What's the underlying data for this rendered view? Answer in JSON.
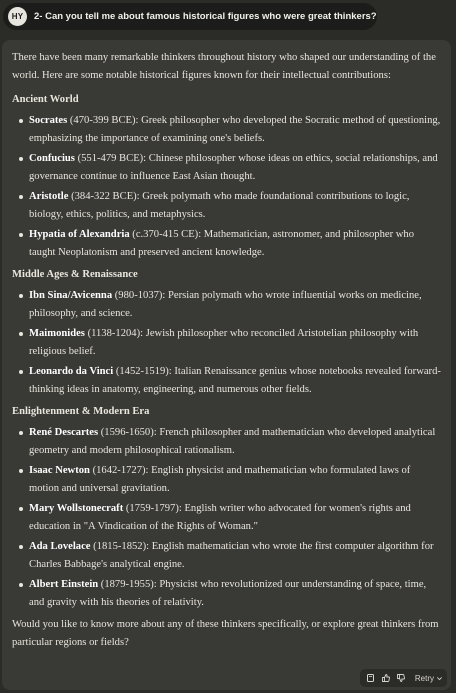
{
  "user_message": {
    "avatar_initials": "HY",
    "text": "2- Can you tell me about famous historical figures who were great thinkers?"
  },
  "answer": {
    "intro": "There have been many remarkable thinkers throughout history who shaped our understanding of the world. Here are some notable historical figures known for their intellectual contributions:",
    "sections": [
      {
        "heading": "Ancient World",
        "items": [
          {
            "name": "Socrates",
            "desc": " (470-399 BCE): Greek philosopher who developed the Socratic method of questioning, emphasizing the importance of examining one's beliefs."
          },
          {
            "name": "Confucius",
            "desc": " (551-479 BCE): Chinese philosopher whose ideas on ethics, social relationships, and governance continue to influence East Asian thought."
          },
          {
            "name": "Aristotle",
            "desc": " (384-322 BCE): Greek polymath who made foundational contributions to logic, biology, ethics, politics, and metaphysics."
          },
          {
            "name": "Hypatia of Alexandria",
            "desc": " (c.370-415 CE): Mathematician, astronomer, and philosopher who taught Neoplatonism and preserved ancient knowledge."
          }
        ]
      },
      {
        "heading": "Middle Ages & Renaissance",
        "items": [
          {
            "name": "Ibn Sina/Avicenna",
            "desc": " (980-1037): Persian polymath who wrote influential works on medicine, philosophy, and science."
          },
          {
            "name": "Maimonides",
            "desc": " (1138-1204): Jewish philosopher who reconciled Aristotelian philosophy with religious belief."
          },
          {
            "name": "Leonardo da Vinci",
            "desc": " (1452-1519): Italian Renaissance genius whose notebooks revealed forward-thinking ideas in anatomy, engineering, and numerous other fields."
          }
        ]
      },
      {
        "heading": "Enlightenment & Modern Era",
        "items": [
          {
            "name": "René Descartes",
            "desc": " (1596-1650): French philosopher and mathematician who developed analytical geometry and modern philosophical rationalism."
          },
          {
            "name": "Isaac Newton",
            "desc": " (1642-1727): English physicist and mathematician who formulated laws of motion and universal gravitation."
          },
          {
            "name": "Mary Wollstonecraft",
            "desc": " (1759-1797): English writer who advocated for women's rights and education in \"A Vindication of the Rights of Woman.\""
          },
          {
            "name": "Ada Lovelace",
            "desc": " (1815-1852): English mathematician who wrote the first computer algorithm for Charles Babbage's analytical engine."
          },
          {
            "name": "Albert Einstein",
            "desc": " (1879-1955): Physicist who revolutionized our understanding of space, time, and gravity with his theories of relativity."
          }
        ]
      }
    ],
    "closing": "Would you like to know more about any of these thinkers specifically, or explore great thinkers from particular regions or fields?"
  },
  "actions": {
    "copy_icon": "copy-icon",
    "thumbs_up_icon": "thumbs-up-icon",
    "thumbs_down_icon": "thumbs-down-icon",
    "retry_label": "Retry",
    "retry_chevron_icon": "chevron-down-icon"
  }
}
